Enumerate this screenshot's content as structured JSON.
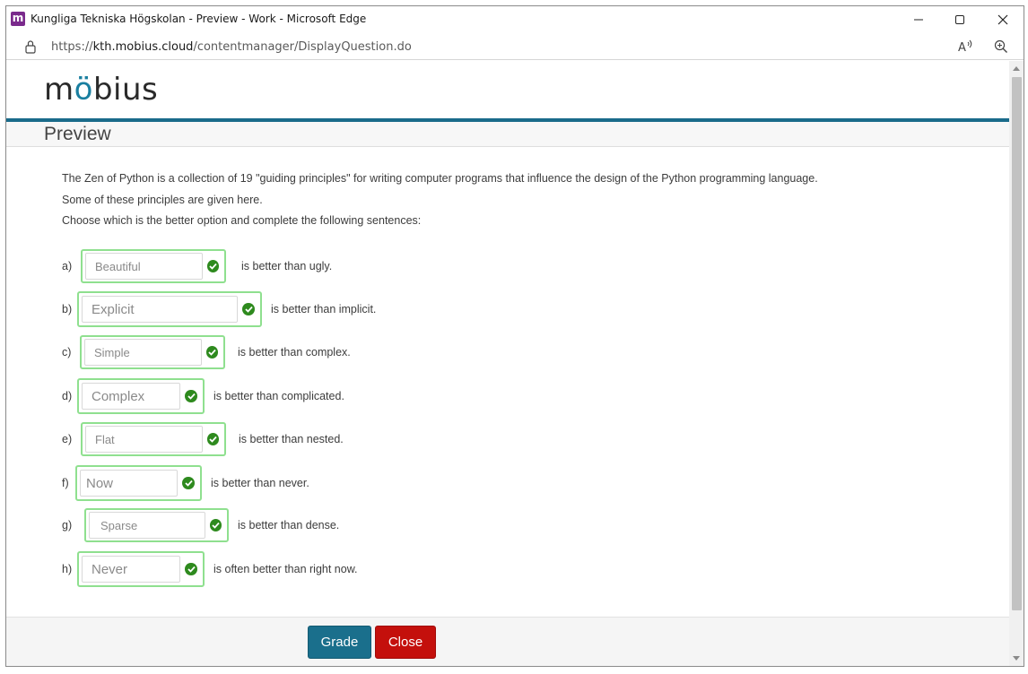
{
  "window": {
    "title": "Kungliga Tekniska Högskolan - Preview - Work - Microsoft Edge",
    "app_icon_letter": "m"
  },
  "address": {
    "url_prefix": "https://",
    "url_domain": "kth.mobius.cloud",
    "url_path": "/contentmanager/DisplayQuestion.do"
  },
  "page": {
    "logo": {
      "part1": "m",
      "part2": "ö",
      "part3": "bius"
    },
    "heading": "Preview",
    "intro": [
      "The Zen of Python is a collection of 19 \"guiding principles\" for writing computer programs that influence the design of the Python programming language.",
      "Some of these principles are given here.",
      "Choose which is the better option and complete the following sentences:"
    ],
    "questions": [
      {
        "label": "a)",
        "answer": "Beautiful",
        "after": "is better than ugly.",
        "status": "correct"
      },
      {
        "label": "b)",
        "answer": "Explicit",
        "after": "is better than implicit.",
        "status": "correct"
      },
      {
        "label": "c)",
        "answer": "Simple",
        "after": "is better than complex.",
        "status": "correct"
      },
      {
        "label": "d)",
        "answer": "Complex",
        "after": "is better than complicated.",
        "status": "correct"
      },
      {
        "label": "e)",
        "answer": "Flat",
        "after": "is better than nested.",
        "status": "correct"
      },
      {
        "label": "f)",
        "answer": "Now",
        "after": "is better than never.",
        "status": "correct"
      },
      {
        "label": "g)",
        "answer": "Sparse",
        "after": "is better than dense.",
        "status": "correct"
      },
      {
        "label": "h)",
        "answer": "Never",
        "after": "is often better than right now.",
        "status": "correct"
      }
    ],
    "buttons": {
      "grade": "Grade",
      "close": "Close"
    }
  },
  "colors": {
    "accent": "#1a6b8a",
    "correct_border": "#8fe08f",
    "check": "#2e8a1e",
    "grade_button": "#1a6f8c",
    "close_button": "#c4100c"
  },
  "icons": [
    "app-icon",
    "minimize-icon",
    "maximize-icon",
    "close-icon",
    "lock-icon",
    "read-aloud-icon",
    "zoom-icon",
    "check-circle-icon"
  ]
}
